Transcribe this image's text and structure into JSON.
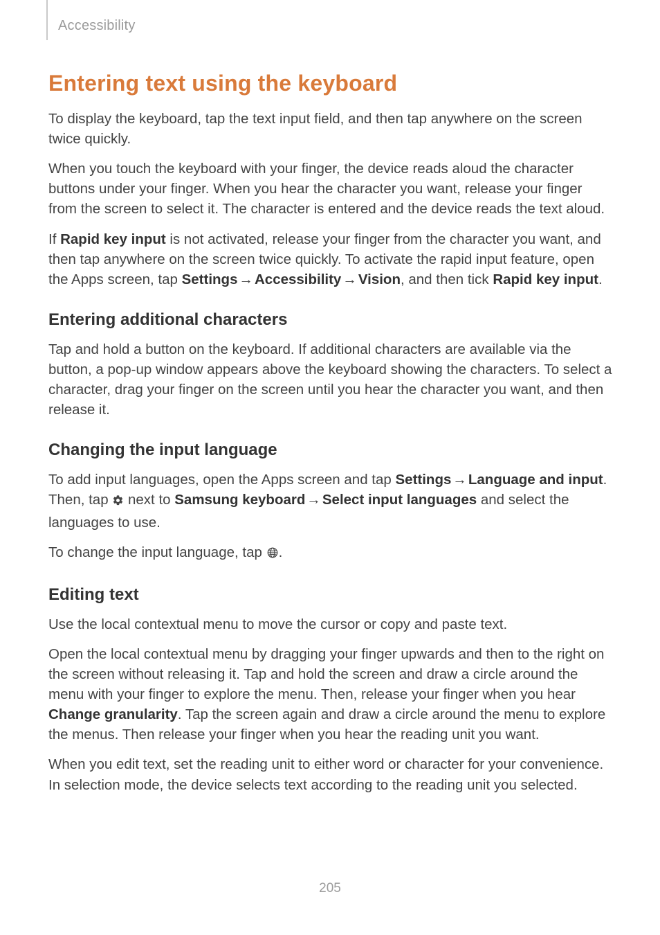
{
  "header": {
    "breadcrumb": "Accessibility"
  },
  "section": {
    "title": "Entering text using the keyboard",
    "p1": "To display the keyboard, tap the text input field, and then tap anywhere on the screen twice quickly.",
    "p2": "When you touch the keyboard with your finger, the device reads aloud the character buttons under your finger. When you hear the character you want, release your finger from the screen to select it. The character is entered and the device reads the text aloud.",
    "p3_a": "If ",
    "p3_b": "Rapid key input",
    "p3_c": " is not activated, release your finger from the character you want, and then tap anywhere on the screen twice quickly. To activate the rapid input feature, open the Apps screen, tap ",
    "p3_d": "Settings",
    "p3_arrow1": " → ",
    "p3_e": "Accessibility",
    "p3_arrow2": " → ",
    "p3_f": "Vision",
    "p3_g": ", and then tick ",
    "p3_h": "Rapid key input",
    "p3_i": "."
  },
  "sub1": {
    "title": "Entering additional characters",
    "p1": "Tap and hold a button on the keyboard. If additional characters are available via the button, a pop-up window appears above the keyboard showing the characters. To select a character, drag your finger on the screen until you hear the character you want, and then release it."
  },
  "sub2": {
    "title": "Changing the input language",
    "p1_a": "To add input languages, open the Apps screen and tap ",
    "p1_b": "Settings",
    "p1_arrow1": " → ",
    "p1_c": "Language and input",
    "p1_d": ". Then, tap ",
    "p1_e": " next to ",
    "p1_f": "Samsung keyboard",
    "p1_arrow2": " → ",
    "p1_g": "Select input languages",
    "p1_h": " and select the languages to use.",
    "p2_a": "To change the input language, tap ",
    "p2_b": "."
  },
  "sub3": {
    "title": "Editing text",
    "p1": "Use the local contextual menu to move the cursor or copy and paste text.",
    "p2_a": "Open the local contextual menu by dragging your finger upwards and then to the right on the screen without releasing it. Tap and hold the screen and draw a circle around the menu with your finger to explore the menu. Then, release your finger when you hear ",
    "p2_b": "Change granularity",
    "p2_c": ". Tap the screen again and draw a circle around the menu to explore the menus. Then release your finger when you hear the reading unit you want.",
    "p3": "When you edit text, set the reading unit to either word or character for your convenience. In selection mode, the device selects text according to the reading unit you selected."
  },
  "footer": {
    "page_number": "205"
  }
}
